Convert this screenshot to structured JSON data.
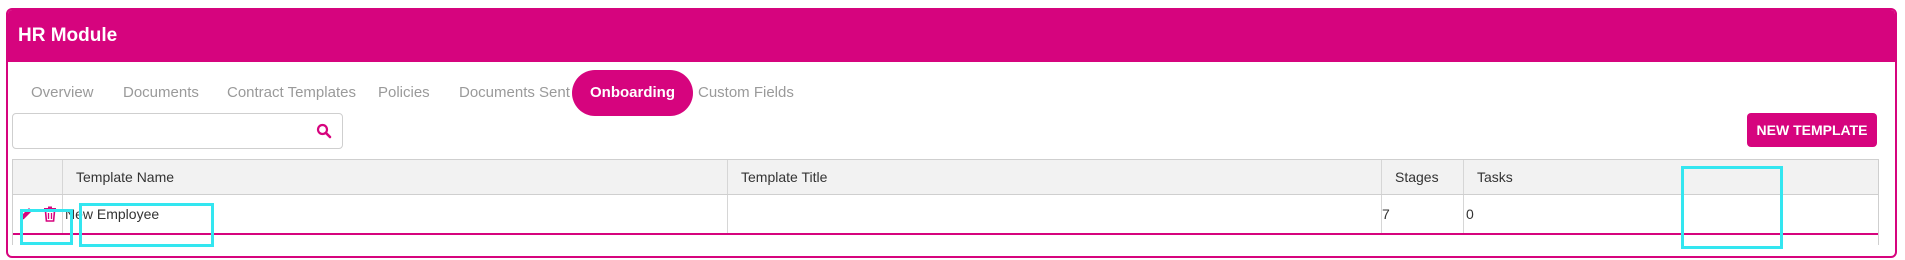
{
  "header": {
    "title": "HR Module"
  },
  "tabs": [
    {
      "label": "Overview",
      "active": false
    },
    {
      "label": "Documents",
      "active": false
    },
    {
      "label": "Contract Templates",
      "active": false
    },
    {
      "label": "Policies",
      "active": false
    },
    {
      "label": "Documents Sent",
      "active": false
    },
    {
      "label": "Onboarding",
      "active": true
    },
    {
      "label": "Custom Fields",
      "active": false
    }
  ],
  "search": {
    "value": "",
    "placeholder": ""
  },
  "toolbar": {
    "new_template_label": "NEW TEMPLATE"
  },
  "table": {
    "columns": [
      "",
      "Template Name",
      "Template Title",
      "Stages",
      "Tasks"
    ],
    "rows": [
      {
        "name": "New Employee",
        "title": "",
        "stages": "7",
        "tasks": "0"
      }
    ]
  },
  "icons": {
    "search": "search-icon",
    "edit": "pencil-icon",
    "delete": "trash-icon"
  },
  "colors": {
    "brand": "#d6047e",
    "highlight": "#33e6f0",
    "inactive_tab": "#9a9a9a",
    "header_row_bg": "#f2f2f2"
  }
}
